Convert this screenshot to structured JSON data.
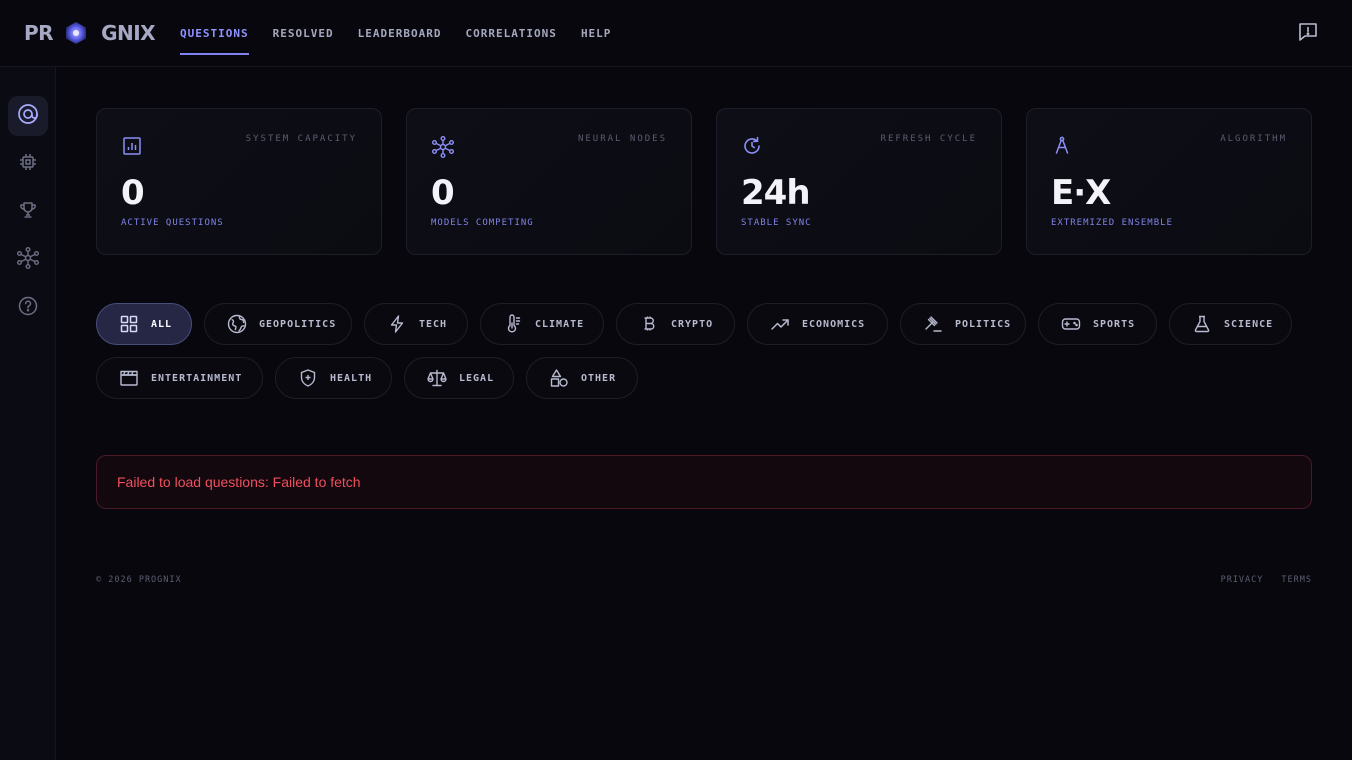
{
  "brand": {
    "left": "PR",
    "right": "GNIX"
  },
  "nav": [
    {
      "label": "QUESTIONS",
      "active": true
    },
    {
      "label": "RESOLVED"
    },
    {
      "label": "LEADERBOARD"
    },
    {
      "label": "CORRELATIONS"
    },
    {
      "label": "HELP"
    }
  ],
  "sidebar": [
    {
      "icon": "target-icon",
      "active": true
    },
    {
      "icon": "chip-icon"
    },
    {
      "icon": "trophy-icon"
    },
    {
      "icon": "network-icon"
    },
    {
      "icon": "help-circle-icon"
    }
  ],
  "stats": [
    {
      "label": "SYSTEM CAPACITY",
      "value": "0",
      "sub": "ACTIVE QUESTIONS",
      "icon": "bar-chart-icon"
    },
    {
      "label": "NEURAL NODES",
      "value": "0",
      "sub": "MODELS COMPETING",
      "icon": "nodes-icon"
    },
    {
      "label": "REFRESH CYCLE",
      "value": "24h",
      "sub": "STABLE SYNC",
      "icon": "refresh-icon"
    },
    {
      "label": "ALGORITHM",
      "value": "E·X",
      "sub": "EXTREMIZED ENSEMBLE",
      "icon": "compass-icon"
    }
  ],
  "categories": [
    {
      "label": "ALL",
      "icon": "grid-icon",
      "active": true
    },
    {
      "label": "GEOPOLITICS",
      "icon": "globe-icon"
    },
    {
      "label": "TECH",
      "icon": "bolt-icon"
    },
    {
      "label": "CLIMATE",
      "icon": "thermometer-icon"
    },
    {
      "label": "CRYPTO",
      "icon": "bitcoin-icon"
    },
    {
      "label": "ECONOMICS",
      "icon": "trend-up-icon"
    },
    {
      "label": "POLITICS",
      "icon": "gavel-icon"
    },
    {
      "label": "SPORTS",
      "icon": "gamepad-icon"
    },
    {
      "label": "SCIENCE",
      "icon": "flask-icon"
    },
    {
      "label": "ENTERTAINMENT",
      "icon": "clapperboard-icon"
    },
    {
      "label": "HEALTH",
      "icon": "shield-plus-icon"
    },
    {
      "label": "LEGAL",
      "icon": "scales-icon"
    },
    {
      "label": "OTHER",
      "icon": "shapes-icon"
    }
  ],
  "error": "Failed to load questions: Failed to fetch",
  "footer": {
    "copyright": "© 2026 PROGNIX",
    "privacy": "PRIVACY",
    "terms": "TERMS"
  },
  "colors": {
    "accent": "#7f82f0",
    "background": "#07070d",
    "error": "#ef4f5f"
  }
}
